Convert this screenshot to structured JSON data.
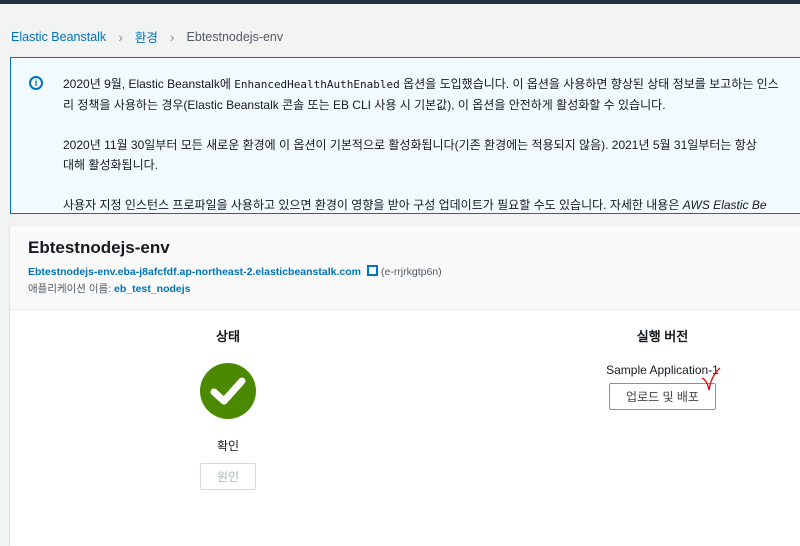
{
  "breadcrumb": {
    "items": [
      "Elastic Beanstalk",
      "환경"
    ],
    "current": "Ebtestnodejs-env"
  },
  "notice": {
    "p1a": "2020년 9월, Elastic Beanstalk에 ",
    "p1code": "EnhancedHealthAuthEnabled",
    "p1b": " 옵션을 도입했습니다. 이 옵션을 사용하면 향상된 상태 정보를 보고하는 인스",
    "p1c": "리 정책을 사용하는 경우(Elastic Beanstalk 콘솔 또는 EB CLI 사용 시 기본값), 이 옵션을 안전하게 활성화할 수 있습니다.",
    "p2a": "2020년 11월 30일부터 모든 새로운 환경에 이 옵션이 기본적으로 활성화됩니다(기존 환경에는 적용되지 않음). 2021년 5월 31일부터는 항상",
    "p2b": "대해 활성화됩니다.",
    "p3a": "사용자 지정 인스턴스 프로파일을 사용하고 있으면 환경이 영향을 받아 구성 업데이트가 필요할 수도 있습니다. 자세한 내용은 ",
    "p3b": "AWS Elastic Be"
  },
  "env": {
    "title": "Ebtestnodejs-env",
    "url": "Ebtestnodejs-env.eba-j8afcfdf.ap-northeast-2.elasticbeanstalk.com",
    "id": "(e-rrjrkgtp6n)",
    "app_label": "애플리케이션 이름: ",
    "app_name": "eb_test_nodejs"
  },
  "health": {
    "heading": "상태",
    "status": "확인",
    "cause_button": "원인",
    "color": "#4b8a00"
  },
  "version": {
    "heading": "실행 버전",
    "name": "Sample Application-1",
    "deploy_button": "업로드 및 배포"
  }
}
